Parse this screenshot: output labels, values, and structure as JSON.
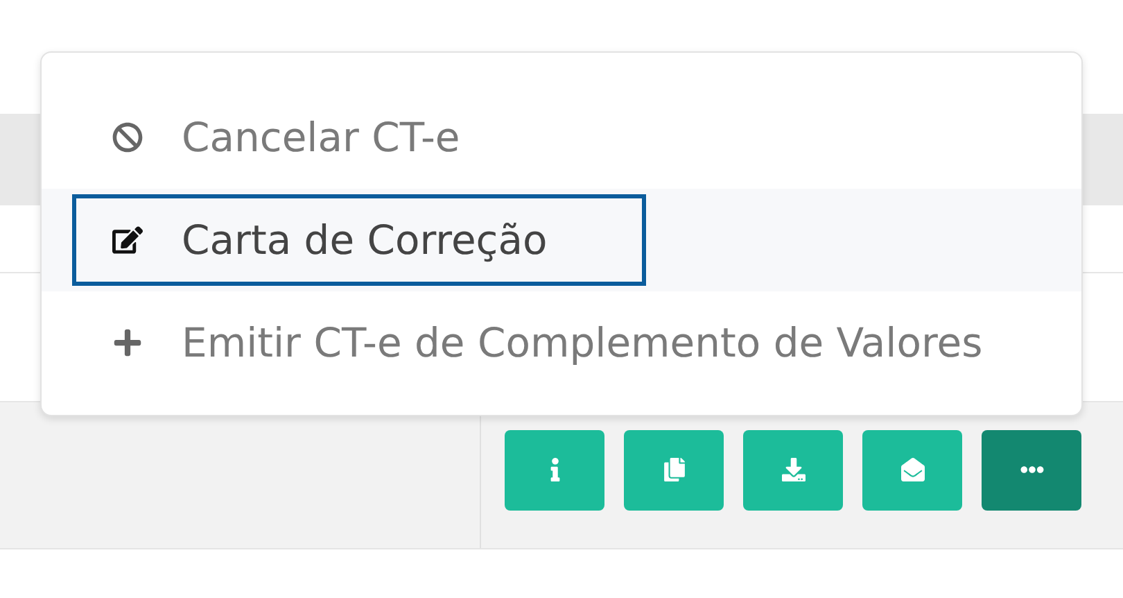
{
  "menu": {
    "items": [
      {
        "kind": "ban",
        "label": "Cancelar CT-e",
        "selected": false
      },
      {
        "kind": "edit",
        "label": "Carta de Correção",
        "selected": true
      },
      {
        "kind": "plus",
        "label": "Emitir CT-e de Complemento de Valores",
        "selected": false
      }
    ]
  },
  "actions": [
    {
      "kind": "info",
      "selected": false
    },
    {
      "kind": "copy",
      "selected": false
    },
    {
      "kind": "download",
      "selected": false
    },
    {
      "kind": "mail",
      "selected": false
    },
    {
      "kind": "more",
      "selected": true
    }
  ]
}
